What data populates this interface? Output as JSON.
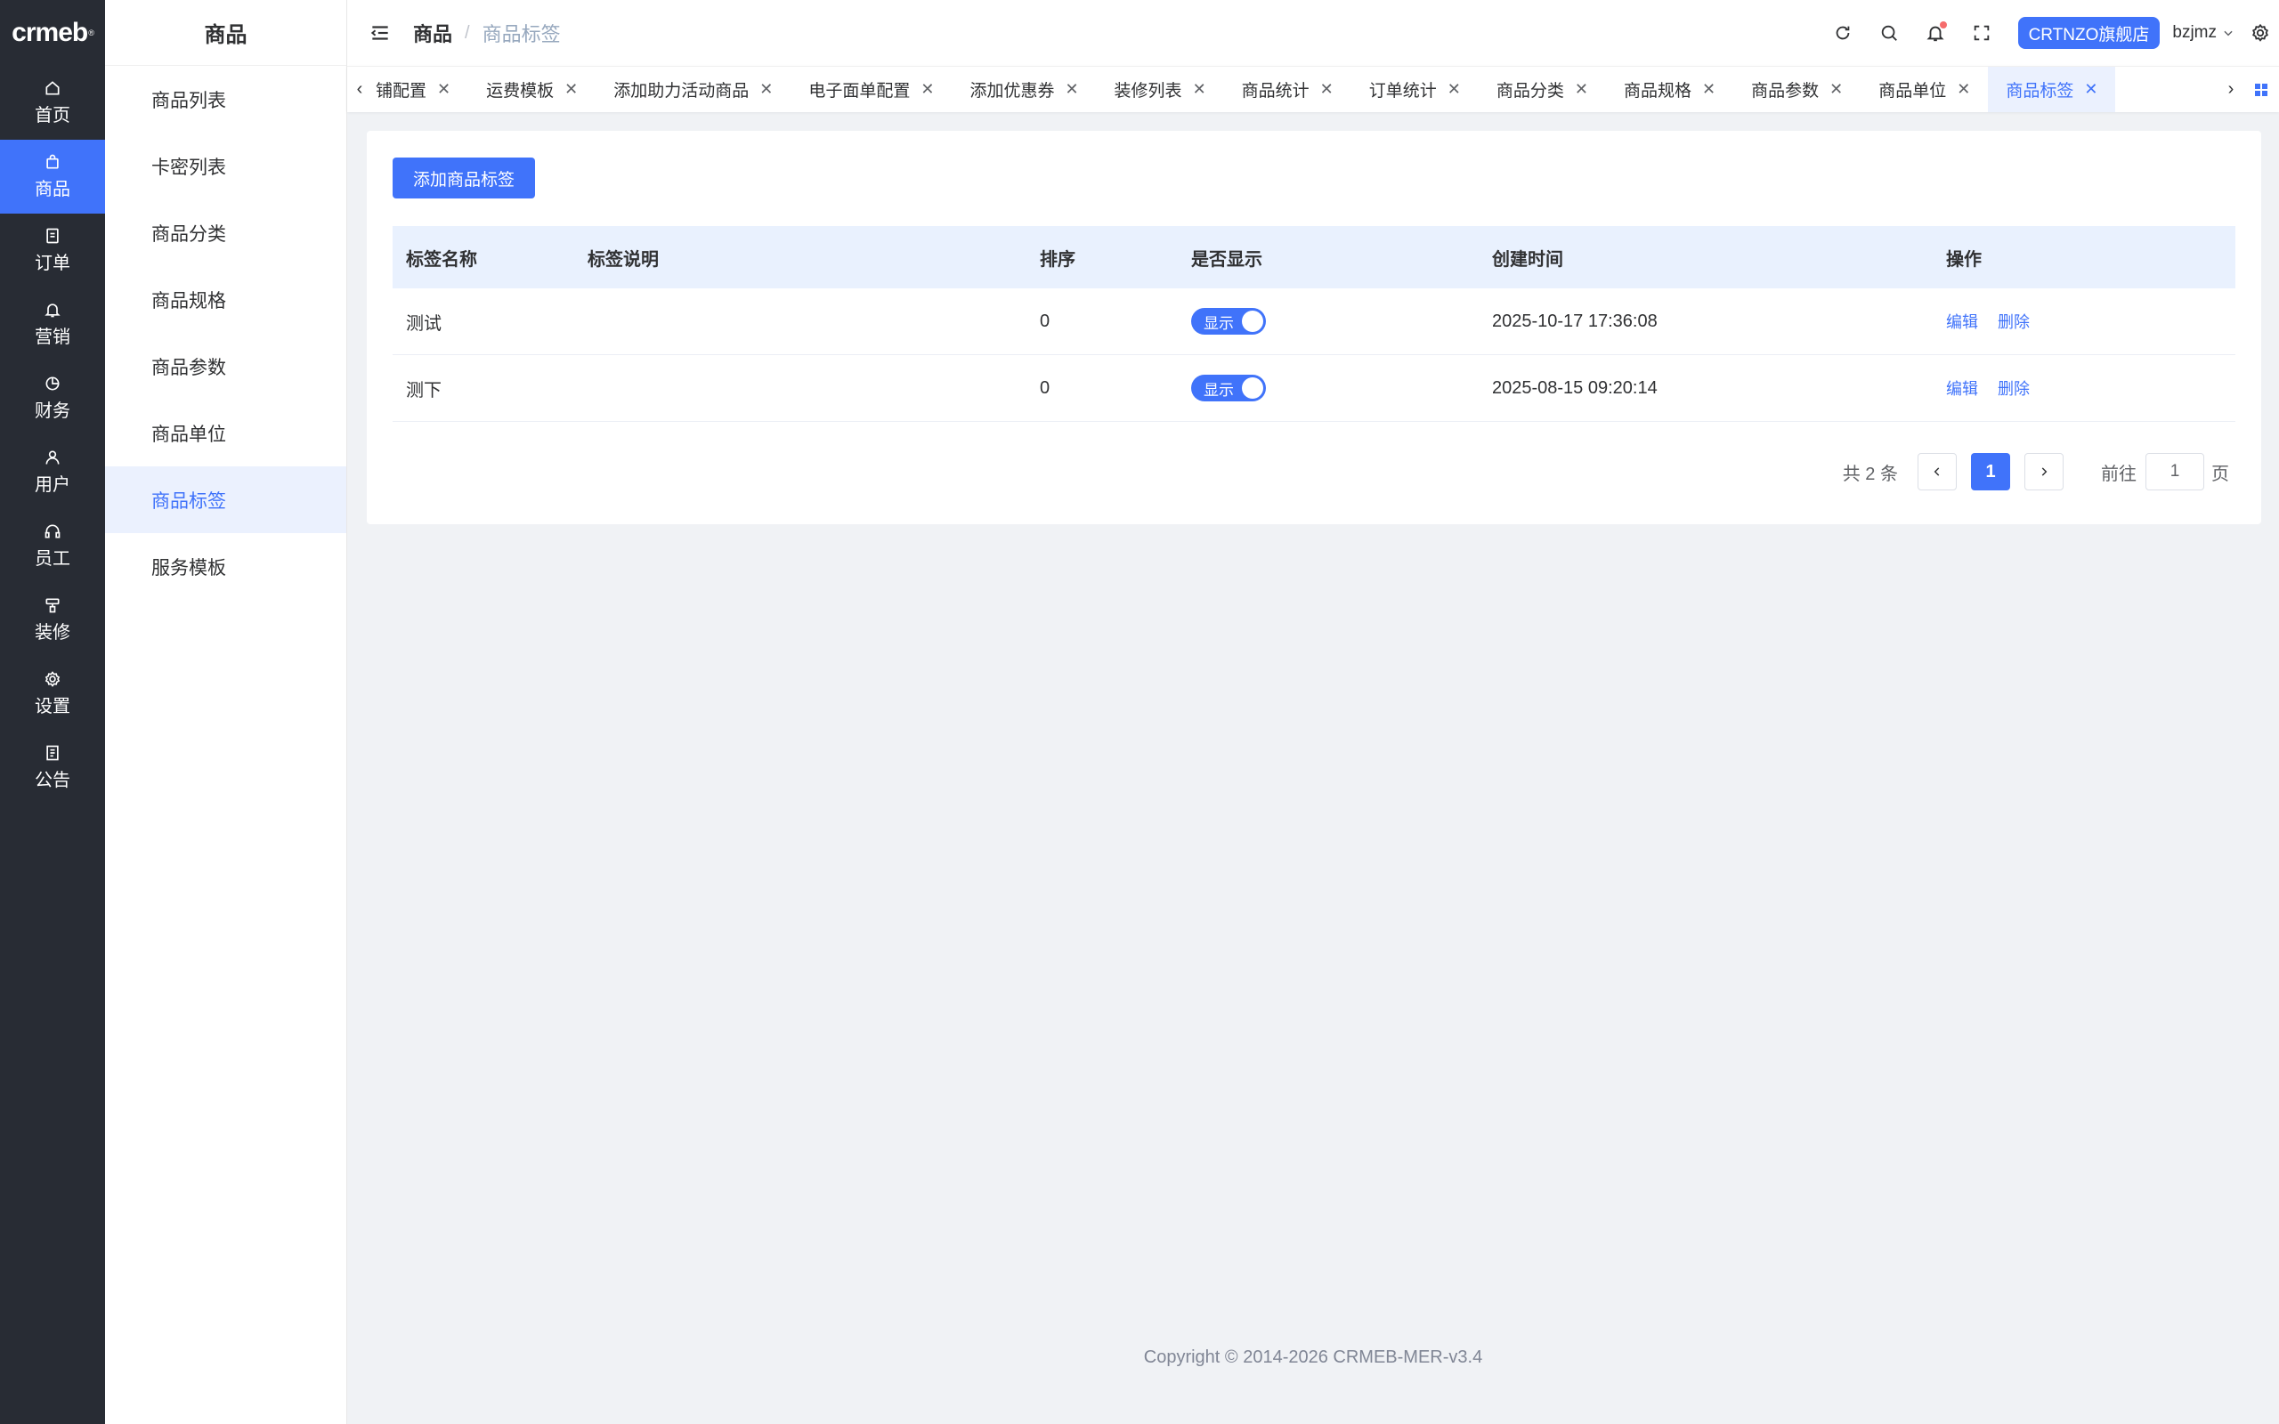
{
  "app": {
    "logo": "crmeb",
    "logo_mark": "®"
  },
  "rail": {
    "items": [
      {
        "label": "首页",
        "icon": "home-icon"
      },
      {
        "label": "商品",
        "icon": "bag-icon",
        "active": true
      },
      {
        "label": "订单",
        "icon": "document-icon"
      },
      {
        "label": "营销",
        "icon": "bell-icon"
      },
      {
        "label": "财务",
        "icon": "pie-icon"
      },
      {
        "label": "用户",
        "icon": "user-icon"
      },
      {
        "label": "员工",
        "icon": "headset-icon"
      },
      {
        "label": "装修",
        "icon": "brush-icon"
      },
      {
        "label": "设置",
        "icon": "gear-icon"
      },
      {
        "label": "公告",
        "icon": "notice-icon"
      }
    ]
  },
  "submenu": {
    "title": "商品",
    "items": [
      "商品列表",
      "卡密列表",
      "商品分类",
      "商品规格",
      "商品参数",
      "商品单位",
      "商品标签",
      "服务模板"
    ],
    "active_index": 6
  },
  "header": {
    "breadcrumb_main": "商品",
    "breadcrumb_sep": "/",
    "breadcrumb_current": "商品标签",
    "store_button": "CRTNZO旗舰店",
    "username": "bzjmz"
  },
  "tabs": {
    "items": [
      "铺配置",
      "运费模板",
      "添加助力活动商品",
      "电子面单配置",
      "添加优惠券",
      "装修列表",
      "商品统计",
      "订单统计",
      "商品分类",
      "商品规格",
      "商品参数",
      "商品单位",
      "商品标签"
    ],
    "active_index": 12,
    "close_glyph": "✕",
    "prev_glyph": "‹",
    "next_glyph": "›"
  },
  "main": {
    "add_button": "添加商品标签",
    "columns": [
      "标签名称",
      "标签说明",
      "排序",
      "是否显示",
      "创建时间",
      "操作"
    ],
    "rows": [
      {
        "name": "测试",
        "desc": "",
        "sort": "0",
        "show": "显示",
        "created": "2025-10-17 17:36:08",
        "edit": "编辑",
        "delete": "删除"
      },
      {
        "name": "测下",
        "desc": "",
        "sort": "0",
        "show": "显示",
        "created": "2025-08-15 09:20:14",
        "edit": "编辑",
        "delete": "删除"
      }
    ],
    "pagination": {
      "total": "共 2 条",
      "current_page": "1",
      "goto_label": "前往",
      "goto_value": "1",
      "page_unit": "页"
    }
  },
  "footer": {
    "copyright": "Copyright © 2014-2026 CRMEB-MER-v3.4"
  },
  "colors": {
    "primary": "#4073fa",
    "rail_bg": "#282c34",
    "active_bg": "#ebf1fe"
  }
}
